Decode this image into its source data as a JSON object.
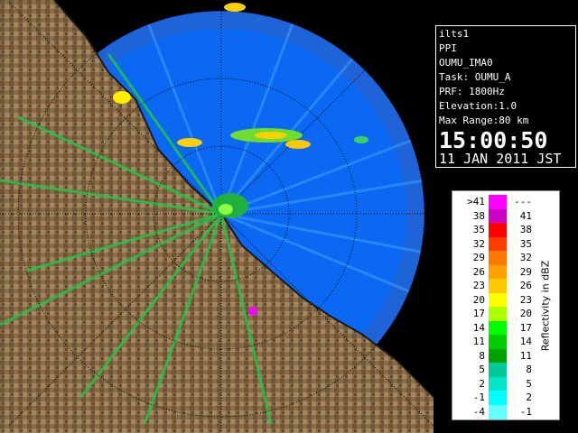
{
  "info": {
    "site": "ilts1",
    "scan_type": "PPI",
    "product": "OUMU_IMA0",
    "task": "Task: OUMU_A",
    "prf": "PRF: 1800Hz",
    "elevation": "Elevation:1.0",
    "max_range": "Max Range:80 km",
    "time": "15:00:50",
    "date": "11 JAN 2011 JST"
  },
  "legend": {
    "title": "Reflectivity in dBZ",
    "rows": [
      {
        "lo": ">41",
        "hi": "---",
        "color": "#ff00ff"
      },
      {
        "lo": "38",
        "hi": "41",
        "color": "#c800c8"
      },
      {
        "lo": "35",
        "hi": "38",
        "color": "#ff0000"
      },
      {
        "lo": "32",
        "hi": "35",
        "color": "#ff3c00"
      },
      {
        "lo": "29",
        "hi": "32",
        "color": "#ff7800"
      },
      {
        "lo": "26",
        "hi": "29",
        "color": "#ffa000"
      },
      {
        "lo": "23",
        "hi": "26",
        "color": "#ffc800"
      },
      {
        "lo": "20",
        "hi": "23",
        "color": "#ffff00"
      },
      {
        "lo": "17",
        "hi": "20",
        "color": "#aaff00"
      },
      {
        "lo": "14",
        "hi": "17",
        "color": "#00ff00"
      },
      {
        "lo": "11",
        "hi": "14",
        "color": "#00cc00"
      },
      {
        "lo": "8",
        "hi": "11",
        "color": "#00a000"
      },
      {
        "lo": "5",
        "hi": "8",
        "color": "#00c896"
      },
      {
        "lo": "2",
        "hi": "5",
        "color": "#00e6c8"
      },
      {
        "lo": "-1",
        "hi": "2",
        "color": "#00ffff"
      },
      {
        "lo": "-4",
        "hi": "-1",
        "color": "#66ffff"
      }
    ]
  },
  "colors": {
    "sea_outer": "#1a6fe6",
    "sea_inner": "#0a5ff0",
    "land": "#8b6f4a",
    "grid": "#000000"
  }
}
